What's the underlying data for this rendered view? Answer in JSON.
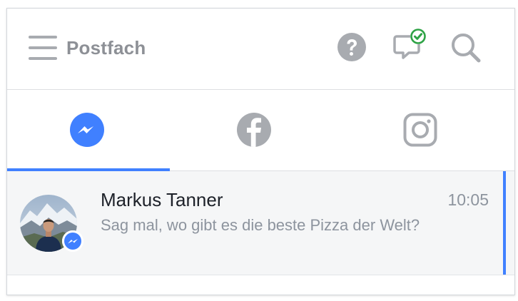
{
  "header": {
    "title": "Postfach",
    "icons": [
      "menu-icon",
      "help-icon",
      "reviewed-messages-icon",
      "search-icon"
    ]
  },
  "tabs": [
    {
      "name": "messenger",
      "icon": "messenger-icon",
      "active": true
    },
    {
      "name": "facebook",
      "icon": "facebook-icon",
      "active": false
    },
    {
      "name": "instagram",
      "icon": "instagram-icon",
      "active": false
    }
  ],
  "conversations": [
    {
      "sender": "Markus Tanner",
      "time": "10:05",
      "preview": "Sag mal, wo gibt es die beste Pizza der Welt?",
      "platform_icon": "messenger-icon",
      "selected": true
    }
  ],
  "colors": {
    "accent": "#4080ff",
    "check_green": "#2fa346",
    "icon_gray": "#a8abb0",
    "row_bg": "#f5f6f7"
  }
}
